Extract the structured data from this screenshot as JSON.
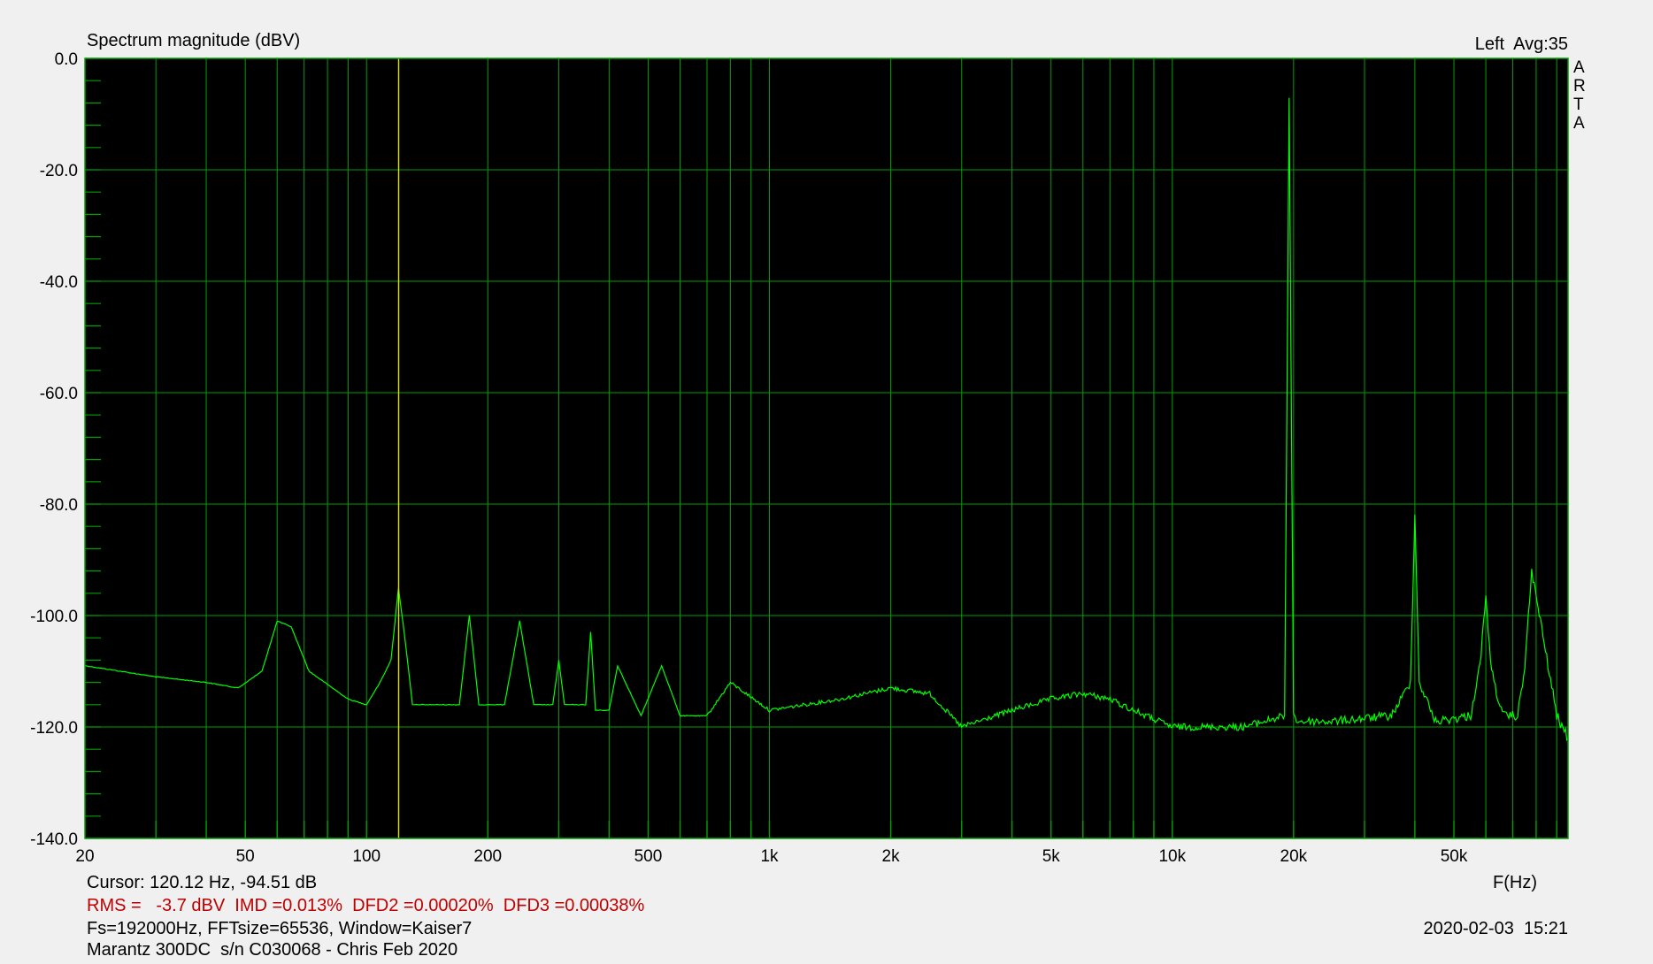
{
  "chart_data": {
    "type": "line",
    "title": "Spectrum magnitude (dBV)",
    "xlabel": "F(Hz)",
    "ylabel": "",
    "xscale": "log",
    "xlim": [
      20,
      96000
    ],
    "ylim": [
      -140,
      0
    ],
    "grid": true,
    "y_ticks": [
      {
        "value": 0,
        "label": "0.0"
      },
      {
        "value": -20,
        "label": "-20.0"
      },
      {
        "value": -40,
        "label": "-40.0"
      },
      {
        "value": -60,
        "label": "-60.0"
      },
      {
        "value": -80,
        "label": "-80.0"
      },
      {
        "value": -100,
        "label": "-100.0"
      },
      {
        "value": -120,
        "label": "-120.0"
      },
      {
        "value": -140,
        "label": "-140.0"
      }
    ],
    "x_ticks": [
      {
        "value": 20,
        "label": "20"
      },
      {
        "value": 50,
        "label": "50"
      },
      {
        "value": 100,
        "label": "100"
      },
      {
        "value": 200,
        "label": "200"
      },
      {
        "value": 500,
        "label": "500"
      },
      {
        "value": 1000,
        "label": "1k"
      },
      {
        "value": 2000,
        "label": "2k"
      },
      {
        "value": 5000,
        "label": "5k"
      },
      {
        "value": 10000,
        "label": "10k"
      },
      {
        "value": 20000,
        "label": "20k"
      },
      {
        "value": 50000,
        "label": "50k"
      }
    ],
    "cursor_hz": 120.12,
    "series": [
      {
        "color": "#00ff00",
        "noise_floor_db": -119,
        "x": [
          20,
          30,
          40,
          48,
          55,
          60,
          65,
          72,
          90,
          100,
          108,
          115,
          120,
          125,
          130,
          150,
          170,
          180,
          190,
          220,
          240,
          260,
          290,
          300,
          310,
          350,
          360,
          370,
          400,
          420,
          480,
          540,
          600,
          700,
          800,
          1000,
          1500,
          2000,
          2500,
          3000,
          4000,
          5000,
          6000,
          7000,
          8000,
          10000,
          15000,
          19000,
          19500,
          20000,
          20500,
          25000,
          35000,
          39000,
          40000,
          41000,
          45000,
          55000,
          58000,
          60000,
          62000,
          66000,
          72000,
          75000,
          78000,
          90000,
          96000
        ],
        "y": [
          -109,
          -111,
          -112,
          -113,
          -110,
          -101,
          -102,
          -110,
          -115,
          -116,
          -112,
          -108,
          -95,
          -105,
          -116,
          -116,
          -116,
          -100,
          -116,
          -116,
          -101,
          -116,
          -116,
          -108,
          -116,
          -116,
          -103,
          -117,
          -117,
          -109,
          -118,
          -109,
          -118,
          -118,
          -112,
          -117,
          -115,
          -113,
          -114,
          -120,
          -117,
          -115,
          -114,
          -115,
          -117,
          -120,
          -120,
          -118,
          -7,
          -118,
          -119,
          -119,
          -118,
          -112,
          -82,
          -112,
          -119,
          -118,
          -109,
          -97,
          -110,
          -118,
          -118,
          -109,
          -92,
          -118,
          -122
        ]
      }
    ]
  },
  "header": {
    "channel_avg": "Left  Avg:35",
    "arta_letters": [
      "A",
      "R",
      "T",
      "A"
    ]
  },
  "footer": {
    "cursor": "Cursor: 120.12 Hz, -94.51 dB",
    "measurements": "RMS =   -3.7 dBV  IMD =0.013%  DFD2 =0.00020%  DFD3 =0.00038%",
    "settings": "Fs=192000Hz, FFTsize=65536, Window=Kaiser7",
    "timestamp": "2020-02-03  15:21",
    "device": "Marantz 300DC  s/n C030068 - Chris Feb 2020"
  },
  "colors": {
    "plot_background": "#000000",
    "grid": "#00a000",
    "trace": "#00ff00",
    "cursor": "#e0e000",
    "measurement_text": "#c00000"
  }
}
